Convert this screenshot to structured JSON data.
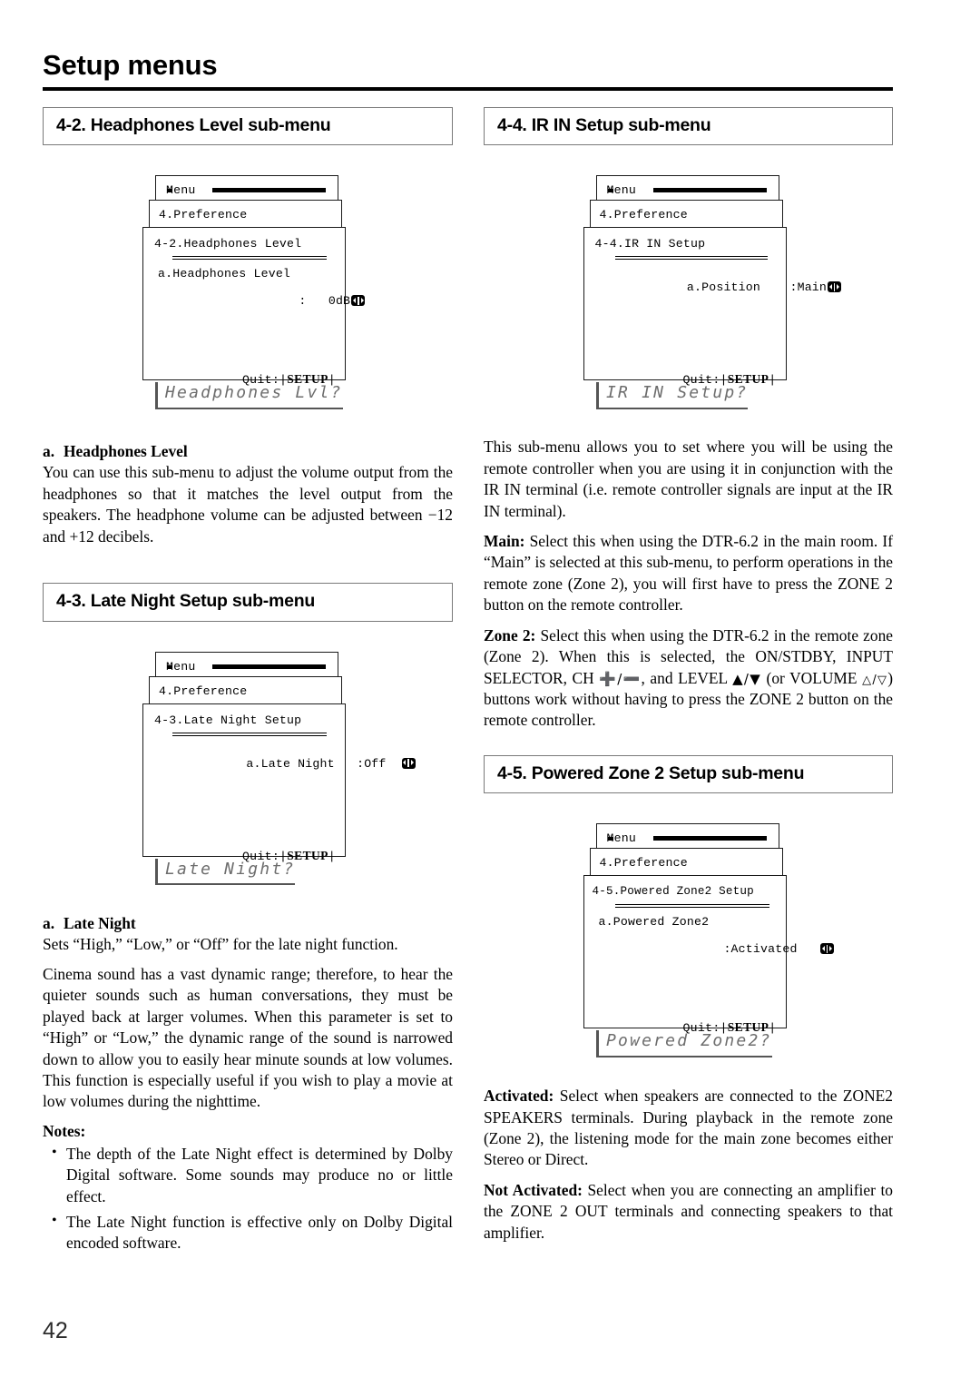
{
  "page": {
    "title": "Setup menus",
    "number": "42"
  },
  "sections": {
    "headphones": {
      "header": "4-2. Headphones Level sub-menu",
      "menu": {
        "root_label": "Menu",
        "parent_label": "4.Preference",
        "title": "4-2.Headphones Level",
        "item_line_1": "a.Headphones Level",
        "item_line_2": ":   0dB",
        "quit_label": "Quit:|",
        "quit_key": "SETUP",
        "quit_close": "|"
      },
      "lcd": "Headphones Lvl?",
      "heading_index": "a.",
      "heading_text": "Headphones Level",
      "paragraph": "You can use this sub-menu to adjust the volume output from the headphones so that it matches the level output from the speakers. The headphone volume can be adjusted between −12 and +12 decibels."
    },
    "late_night": {
      "header": "4-3. Late Night Setup sub-menu",
      "menu": {
        "root_label": "Menu",
        "parent_label": "4.Preference",
        "title": "4-3.Late Night Setup",
        "item_line_1": "a.Late Night   :Off",
        "quit_label": "Quit:|",
        "quit_key": "SETUP",
        "quit_close": "|"
      },
      "lcd": "Late Night?",
      "heading_index": "a.",
      "heading_text": "Late Night",
      "paragraph_1": "Sets “High,” “Low,” or “Off” for the late night function.",
      "paragraph_2": "Cinema sound has a vast dynamic range; therefore, to hear the quieter sounds such as human conversations, they must be played back at larger volumes. When this parameter is set to “High” or “Low,” the dynamic range of the sound is narrowed down to allow you to easily hear minute sounds at low volumes. This function is especially useful if you wish to play a movie at low volumes during the nighttime.",
      "notes_label": "Notes:",
      "notes": [
        "The depth of the Late Night effect is determined by Dolby Digital software. Some sounds may produce no or little effect.",
        "The Late Night function is effective only on Dolby Digital encoded software."
      ]
    },
    "ir_in": {
      "header": "4-4. IR IN Setup sub-menu",
      "menu": {
        "root_label": "Menu",
        "parent_label": "4.Preference",
        "title": "4-4.IR IN Setup",
        "item_line_1": "a.Position    :Main",
        "quit_label": "Quit:|",
        "quit_key": "SETUP",
        "quit_close": "|"
      },
      "lcd": "IR IN Setup?",
      "paragraph_intro": "This sub-menu allows you to set where you will be using the remote controller when you are using it in conjunction with the IR IN terminal (i.e. remote controller signals are input at the IR IN terminal).",
      "main_label": "Main:",
      "main_text": " Select this when using the DTR-6.2 in the main room. If “Main” is selected at this sub-menu, to perform operations in the remote zone (Zone 2), you will first have to press the ZONE 2 button on the remote controller.",
      "zone2_label": "Zone 2:",
      "zone2_text_a": " Select this when using the DTR-6.2 in the remote zone (Zone 2). When this is selected, the ON/STDBY, INPUT SELECTOR, CH ",
      "zone2_sym_ch": "➕/➖",
      "zone2_text_b": ", and LEVEL ",
      "zone2_sym_level": "▲/▼",
      "zone2_text_c": " (or VOLUME ",
      "zone2_sym_volume": "△/▽",
      "zone2_text_d": ") buttons work without having to press the ZONE 2 button on the remote controller."
    },
    "powered_zone2": {
      "header": "4-5. Powered Zone 2 Setup sub-menu",
      "menu": {
        "root_label": "Menu",
        "parent_label": "4.Preference",
        "title": "4-5.Powered Zone2 Setup",
        "item_line_1": "a.Powered Zone2",
        "item_line_2": "     :Activated",
        "quit_label": "Quit:|",
        "quit_key": "SETUP",
        "quit_close": "|"
      },
      "lcd": "Powered Zone2?",
      "activated_label": "Activated:",
      "activated_text": " Select when speakers are connected to the ZONE2 SPEAKERS terminals. During playback in the remote zone (Zone 2), the listening mode for the main zone becomes either Stereo or Direct.",
      "not_activated_label": "Not Activated:",
      "not_activated_text": " Select when you are connecting an amplifier to the ZONE 2 OUT terminals and connecting speakers to that amplifier."
    }
  }
}
